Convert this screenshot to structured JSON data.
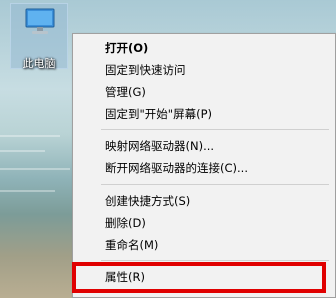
{
  "desktop": {
    "icon_name": "computer-icon",
    "icon_label": "此电脑"
  },
  "context_menu": {
    "items": [
      {
        "label": "打开(O)",
        "bold": true
      },
      {
        "label": "固定到快速访问"
      },
      {
        "label": "管理(G)"
      },
      {
        "label": "固定到\"开始\"屏幕(P)"
      },
      {
        "label": "映射网络驱动器(N)..."
      },
      {
        "label": "断开网络驱动器的连接(C)..."
      },
      {
        "label": "创建快捷方式(S)"
      },
      {
        "label": "删除(D)"
      },
      {
        "label": "重命名(M)"
      },
      {
        "label": "属性(R)"
      }
    ]
  },
  "colors": {
    "highlight_border": "#e00000",
    "menu_background": "#f2f2f2"
  }
}
